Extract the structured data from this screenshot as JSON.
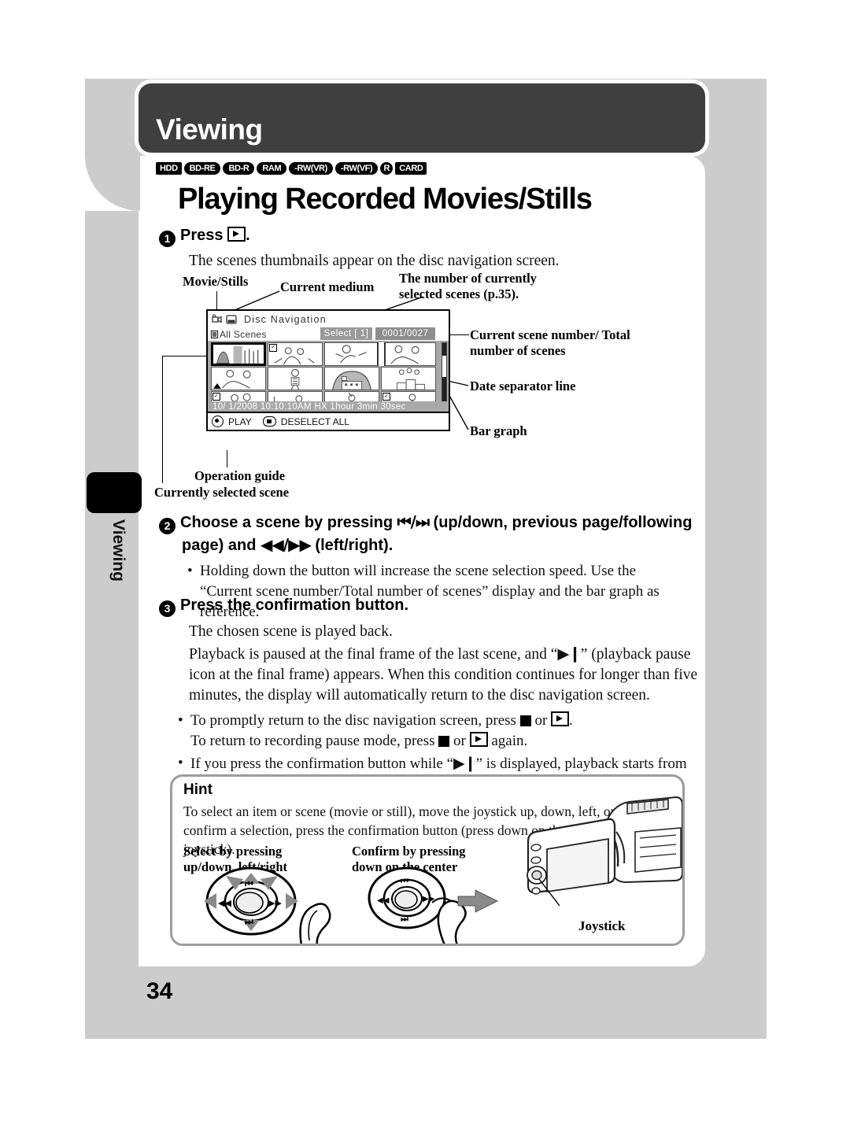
{
  "page": {
    "chapter_title": "Viewing",
    "side_tab_label": "Viewing",
    "page_number": "34",
    "main_heading": "Playing Recorded Movies/Stills"
  },
  "media_badges": [
    {
      "label": "HDD",
      "shape": "rect"
    },
    {
      "label": "BD-RE",
      "shape": "pill"
    },
    {
      "label": "BD-R",
      "shape": "pill"
    },
    {
      "label": "RAM",
      "shape": "pill"
    },
    {
      "label": "-RW(VR)",
      "shape": "pill"
    },
    {
      "label": "-RW(VF)",
      "shape": "pill"
    },
    {
      "label": "R",
      "shape": "circ"
    },
    {
      "label": "CARD",
      "shape": "rect"
    }
  ],
  "steps": {
    "one": {
      "number": "1",
      "title_before": "Press",
      "title_after": ".",
      "body": "The scenes thumbnails appear on the disc navigation screen."
    },
    "two": {
      "number": "2",
      "line1_a": "Choose a scene by pressing",
      "line1_b": "(up/down, previous page/following",
      "line2_a": "page) and",
      "line2_b": "(left/right).",
      "bullet1": "Holding down the button will increase the scene selection speed. Use the “Current scene number/Total number of scenes” display and the bar graph as reference."
    },
    "three": {
      "number": "3",
      "title": "Press the confirmation button.",
      "body1": "The chosen scene is played back.",
      "body2_a": "Playback is paused at the final frame of the last scene, and “",
      "body2_b": "” (playback pause icon at the final frame) appears. When this condition continues for longer than five minutes, the display will automatically return to the disc navigation screen.",
      "bullet1_a": "To promptly return to the disc navigation screen, press",
      "bullet1_or": "or",
      "bullet1_end": ".",
      "bullet1_line2_a": "To return to recording pause mode, press",
      "bullet1_line2_end": "again.",
      "bullet2_a": "If you press the confirmation button while “",
      "bullet2_b": "” is displayed, playback starts from the first scene."
    }
  },
  "callouts": {
    "movie_stills": "Movie/Stills",
    "current_medium": "Current medium",
    "selected_count": "The number of currently selected scenes (p.35).",
    "scene_number": "Current scene number/ Total number of scenes",
    "date_separator": "Date separator line",
    "bar_graph": "Bar graph",
    "operation_guide": "Operation guide",
    "currently_selected": "Currently selected scene"
  },
  "device_screen": {
    "title": "Disc  Navigation",
    "all_scenes": "All Scenes",
    "select_label": "Select [    1]",
    "counter": "0001/0027",
    "status": "10/ 1/2008  10:10:10AM   HX  1hour 3min 30sec",
    "guide_play": "PLAY",
    "guide_deselect": "DESELECT ALL",
    "thumbnails": [
      {
        "index": 1,
        "selected": true,
        "checked": false,
        "markers": 0
      },
      {
        "index": 2,
        "selected": false,
        "checked": true,
        "markers": 0
      },
      {
        "index": 3,
        "selected": false,
        "checked": false,
        "markers": 0
      },
      {
        "index": 4,
        "selected": false,
        "checked": false,
        "markers": 0
      },
      {
        "index": 5,
        "selected": false,
        "checked": false,
        "markers": 1
      },
      {
        "index": 6,
        "selected": false,
        "checked": false,
        "markers": 0
      },
      {
        "index": 7,
        "selected": false,
        "checked": false,
        "markers": 0
      },
      {
        "index": 8,
        "selected": false,
        "checked": false,
        "markers": 0
      },
      {
        "index": 9,
        "selected": false,
        "checked": true,
        "markers": 2
      },
      {
        "index": 10,
        "selected": false,
        "checked": false,
        "markers": 0
      },
      {
        "index": 11,
        "selected": false,
        "checked": false,
        "markers": 0
      },
      {
        "index": 12,
        "selected": false,
        "checked": true,
        "markers": 0
      }
    ]
  },
  "hint": {
    "title": "Hint",
    "text": "To select an item or scene (movie or still), move the joystick up, down, left, or right. To confirm a selection, press the confirmation button (press down on the center of the joystick).",
    "left_label_line1": "Select by pressing",
    "left_label_line2": "up/down, left/right",
    "right_label_line1": "Confirm by pressing",
    "right_label_line2": "down on the center",
    "joystick_label": "Joystick"
  },
  "colors": {
    "page_gray": "#cccccc",
    "header_bar": "#3f3f3f",
    "screen_gray": "#a8a8a8",
    "hint_border": "#9d9d9d"
  }
}
